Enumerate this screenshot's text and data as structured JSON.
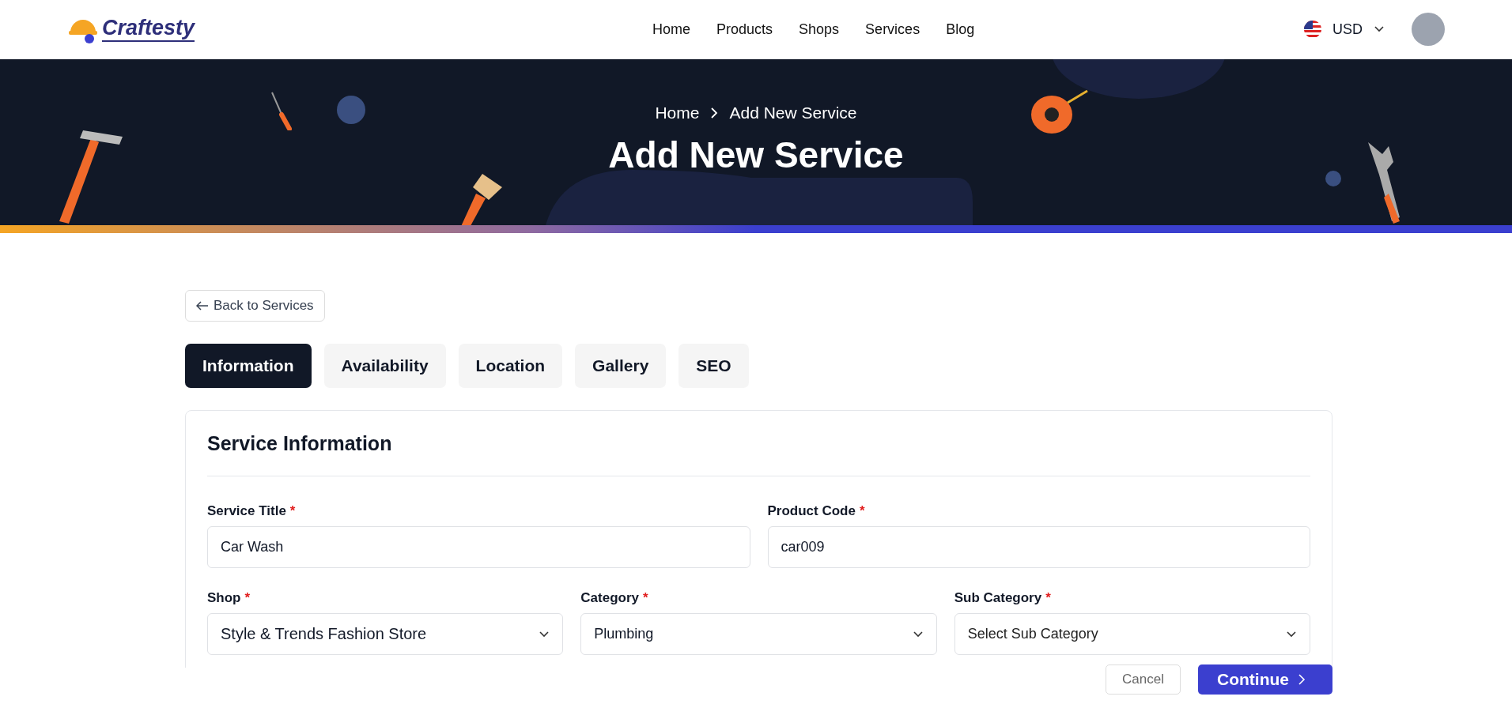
{
  "header": {
    "logo": "Craftesty",
    "nav": [
      {
        "label": "Home"
      },
      {
        "label": "Products"
      },
      {
        "label": "Shops"
      },
      {
        "label": "Services"
      },
      {
        "label": "Blog"
      }
    ],
    "currency": "USD"
  },
  "hero": {
    "breadcrumb": [
      "Home",
      "Add New Service"
    ],
    "title": "Add New Service"
  },
  "back_link": "Back to Services",
  "tabs": [
    {
      "label": "Information",
      "selected": true
    },
    {
      "label": "Availability",
      "selected": false
    },
    {
      "label": "Location",
      "selected": false
    },
    {
      "label": "Gallery",
      "selected": false
    },
    {
      "label": "SEO",
      "selected": false
    }
  ],
  "section": {
    "title": "Service Information",
    "rows": [
      [
        {
          "label": "Service Title",
          "required_mark": "*",
          "kind": "input",
          "value": "Car Wash"
        },
        {
          "label": "Product Code",
          "required_mark": "*",
          "kind": "input",
          "value": "car009"
        }
      ],
      [
        {
          "label": "Shop",
          "required_mark": "*",
          "kind": "select",
          "value": "Style & Trends Fashion Store"
        },
        {
          "label": "Category",
          "required_mark": "*",
          "kind": "select",
          "value": "Plumbing"
        },
        {
          "label": "Sub Category",
          "required_mark": "*",
          "kind": "select",
          "placeholder": "Select Sub Category"
        }
      ]
    ]
  },
  "actions": [
    {
      "label": "Cancel",
      "kind": "secondary"
    },
    {
      "label": "Continue",
      "kind": "primary"
    }
  ]
}
